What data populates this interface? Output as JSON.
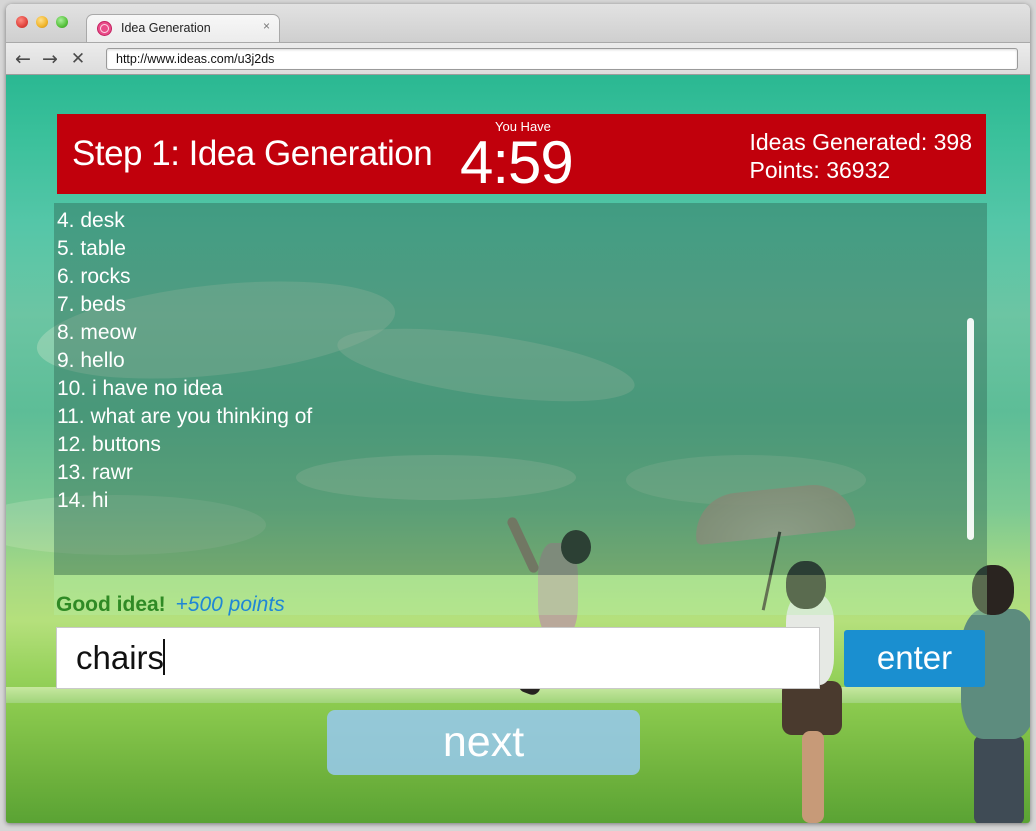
{
  "browser": {
    "tab_title": "Idea Generation",
    "tab_close": "×",
    "url": "http://www.ideas.com/u3j2ds",
    "nav": {
      "back": "←",
      "forward": "→",
      "stop": "✕"
    }
  },
  "header": {
    "step_title": "Step 1: Idea Generation",
    "timer_caption": "You Have",
    "timer": "4:59",
    "ideas_generated": "Ideas Generated: 398",
    "points": "Points: 36932",
    "color": "#c1000c"
  },
  "ideas": [
    "4. desk",
    "5. table",
    "6. rocks",
    "7. beds",
    "8. meow",
    "9. hello",
    "10. i have no idea",
    "11. what are you thinking of",
    "12. buttons",
    "13. rawr",
    "14. hi"
  ],
  "feedback": {
    "message": "Good idea!",
    "points": "+500 points"
  },
  "input": {
    "value": "chairs"
  },
  "buttons": {
    "enter": "enter",
    "next": "next"
  },
  "colors": {
    "enter_button": "#1a8fd0",
    "feedback_good": "#2f8a25",
    "feedback_points": "#1f86d6"
  }
}
